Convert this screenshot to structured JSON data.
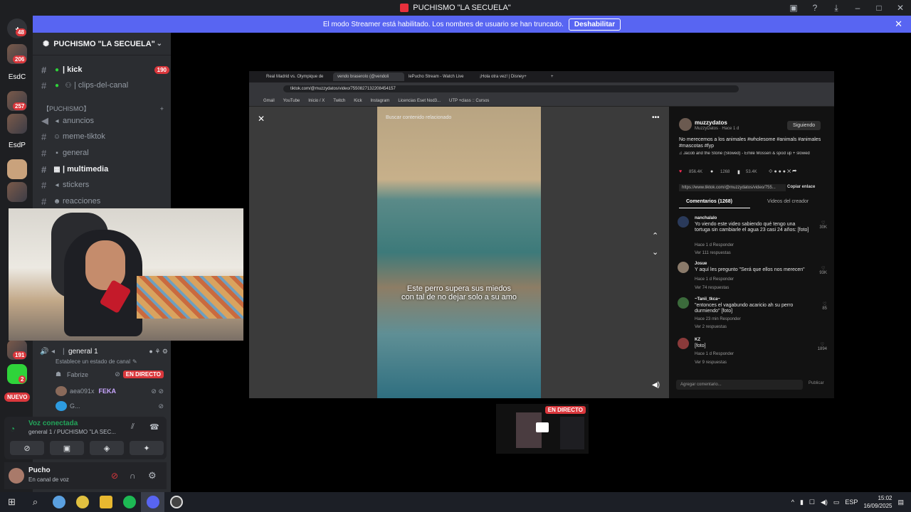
{
  "window": {
    "title": "PUCHISMO \"LA SECUELA\""
  },
  "banner": {
    "text": "El modo Streamer está habilitado. Los nombres de usuario se han truncado.",
    "button": "Deshabilitar"
  },
  "rail": {
    "badges": [
      "48",
      "206",
      "257",
      "191",
      "2"
    ],
    "labels": [
      "EsdC",
      "EsdP"
    ],
    "new_label": "NUEVO"
  },
  "server": {
    "name": "PUCHISMO \"LA SECUELA\""
  },
  "channels": [
    {
      "name": "| kick",
      "count": "190"
    },
    {
      "name": "| clips-del-canal"
    },
    {
      "name": "anuncios"
    },
    {
      "name": "meme-tiktok"
    },
    {
      "name": "general"
    },
    {
      "name": "| multimedia"
    },
    {
      "name": "stickers"
    },
    {
      "name": "reacciones"
    }
  ],
  "category": "【PUCHISMO】",
  "voice": {
    "channel": "general 1",
    "status_placeholder": "Establece un estado de canal",
    "members": [
      {
        "name": "Fabrize",
        "live": "EN DIRECTO"
      },
      {
        "name": "aea091x",
        "tag": "FEKA"
      },
      {
        "name": "G..."
      }
    ]
  },
  "voice_panel": {
    "status": "Voz conectada",
    "location": "general 1 / PUCHISMO \"LA SEC..."
  },
  "user": {
    "name": "Pucho",
    "status": "En canal de voz"
  },
  "stream": {
    "tabs": [
      "Real Madrid vs. Olympique de",
      "vendo braseroIo (@vendoli",
      "lePucho Stream - Watch Live",
      "¡Hola otra vez! | Disney+"
    ],
    "url": "tiktok.com/@muzzydatos/video/7550827132208454157",
    "bookmarks": [
      "Gmail",
      "YouTube",
      "Inicio / X",
      "Twitch",
      "Kick",
      "Instagram",
      "Licencias Eset Nod3...",
      "UTP +class :: Cursos"
    ],
    "search_placeholder": "Buscar contenido relacionado",
    "caption_line1": "Este perro supera sus miedos",
    "caption_line2": "con tal de no dejar solo a su amo",
    "author": "muzzydatos",
    "author_sub": "MuzzyDatos · Hace 1 d",
    "follow": "Siguiendo",
    "description": "No merecemos a los animales #wholesome #animals #animales #mascotas #fyp",
    "music": "♫ Jacob and the Stone (Slowed) - Emile Mosseri & spod up + slowed",
    "stats": [
      "856.4K",
      "1268",
      "53.4K"
    ],
    "link": "https://www.tiktok.com/@muzzydatos/video/755...",
    "copy_link": "Copiar enlace",
    "tab_comments": "Comentarios (1268)",
    "tab_creator": "Videos del creador",
    "comments": [
      {
        "user": "nanchalalo",
        "text": "Yo viendo este video sabiendo qué tengo una tortuga sin cambiarle el agua 23 casi 24 años: [foto]",
        "meta": "Hace 1 d   Responder",
        "replies": "Ver 111 respuestas",
        "likes": "30K"
      },
      {
        "user": "Josue",
        "text": "Y aquí les pregunto \"Será que ellos nos merecen\"",
        "meta": "Hace 1 d   Responder",
        "replies": "Ver 74 respuestas",
        "likes": "93K"
      },
      {
        "user": "~Tanii_tkca~",
        "text": "\"entonces el vagabundo acaricio ah su perro durmiendo\" [foto]",
        "meta": "Hace 23 min   Responder",
        "replies": "Ver 2 respuestas",
        "likes": "85"
      },
      {
        "user": "KZ",
        "text": "[foto]",
        "meta": "Hace 1 d   Responder",
        "replies": "Ver 9 respuestas",
        "likes": "1894"
      }
    ],
    "add_comment": "Agregar comentario...",
    "publish": "Publicar"
  },
  "thumb": {
    "live": "EN DIRECTO"
  },
  "taskbar": {
    "lang": "ESP",
    "time": "15:02",
    "date": "16/09/2025"
  }
}
